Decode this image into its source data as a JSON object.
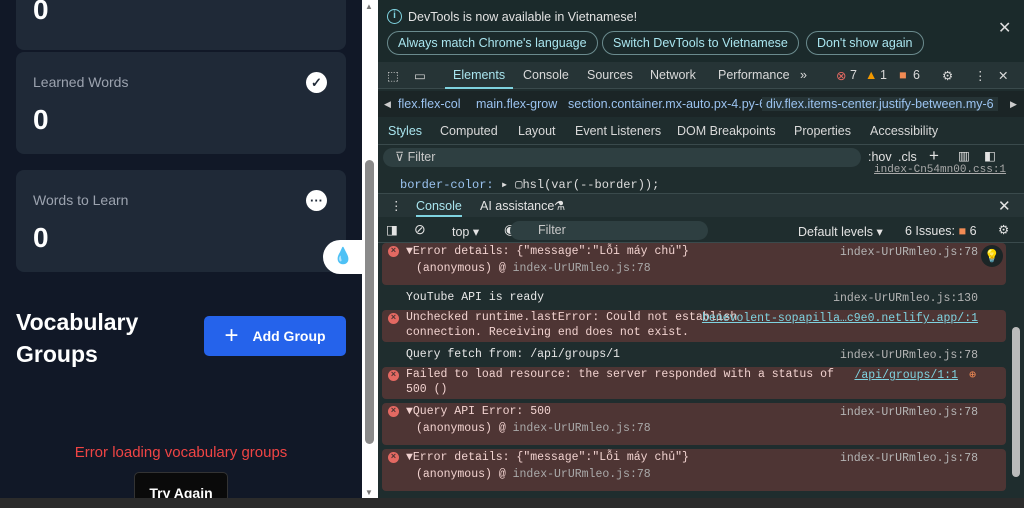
{
  "page": {
    "top_card_value": "0",
    "cards": [
      {
        "label": "Learned Words",
        "value": "0",
        "icon": "check-circle-icon"
      },
      {
        "label": "Words to Learn",
        "value": "0",
        "icon": "more-horizontal-icon"
      }
    ],
    "section_title": "Vocabulary Groups",
    "add_group_label": "Add Group",
    "error_message": "Error loading vocabulary groups",
    "try_again_label": "Try Again"
  },
  "devtools": {
    "infobar": {
      "message": "DevTools is now available in Vietnamese!",
      "buttons": [
        "Always match Chrome's language",
        "Switch DevTools to Vietnamese",
        "Don't show again"
      ]
    },
    "tabs": [
      "Elements",
      "Console",
      "Sources",
      "Network",
      "Performance"
    ],
    "active_tab": "Elements",
    "counts": {
      "errors": "7",
      "warnings": "1",
      "issues": "6"
    },
    "breadcrumbs": [
      "flex.flex-col",
      "main.flex-grow",
      "section.container.mx-auto.px-4.py-6",
      "div.flex.items-center.justify-between.my-6"
    ],
    "subtabs": [
      "Styles",
      "Computed",
      "Layout",
      "Event Listeners",
      "DOM Breakpoints",
      "Properties",
      "Accessibility"
    ],
    "styles_filter_placeholder": "Filter",
    "styles_tools": {
      "hov": ":hov",
      "cls": ".cls"
    },
    "style_source": "index-Cn54mn00.css:1",
    "style_prop": "border-color:",
    "style_value": "hsl(var(--border));",
    "drawer_tabs": [
      "Console",
      "AI assistance"
    ],
    "console": {
      "context": "top",
      "filter_placeholder": "Filter",
      "levels": "Default levels",
      "issues_label": "6 Issues:",
      "issues_count": "6",
      "messages": [
        {
          "type": "error",
          "text": "▼Error details: {\"message\":\"Lỗi máy chủ\"}",
          "sub": "(anonymous) @ ",
          "sublink": "index-UrURmleo.js:78",
          "source": "index-UrURmleo.js:78"
        },
        {
          "type": "log",
          "text": "YouTube API is ready",
          "source": "index-UrURmleo.js:130"
        },
        {
          "type": "error",
          "text": "Unchecked runtime.lastError: Could not establish connection. Receiving end does not exist.",
          "source": "benevolent-sopapilla…c9e0.netlify.app/:1"
        },
        {
          "type": "log",
          "text": "Query fetch from: /api/groups/1",
          "source": "index-UrURmleo.js:78"
        },
        {
          "type": "error",
          "text": "Failed to load resource: the server responded with a status of 500 ()",
          "source": "/api/groups/1:1"
        },
        {
          "type": "error",
          "text": "▼Query API Error: 500",
          "sub": "(anonymous) @ ",
          "sublink": "index-UrURmleo.js:78",
          "source": "index-UrURmleo.js:78"
        },
        {
          "type": "error",
          "text": "▼Error details: {\"message\":\"Lỗi máy chủ\"}",
          "sub": "(anonymous) @ ",
          "sublink": "index-UrURmleo.js:78",
          "source": "index-UrURmleo.js:78"
        }
      ]
    }
  }
}
